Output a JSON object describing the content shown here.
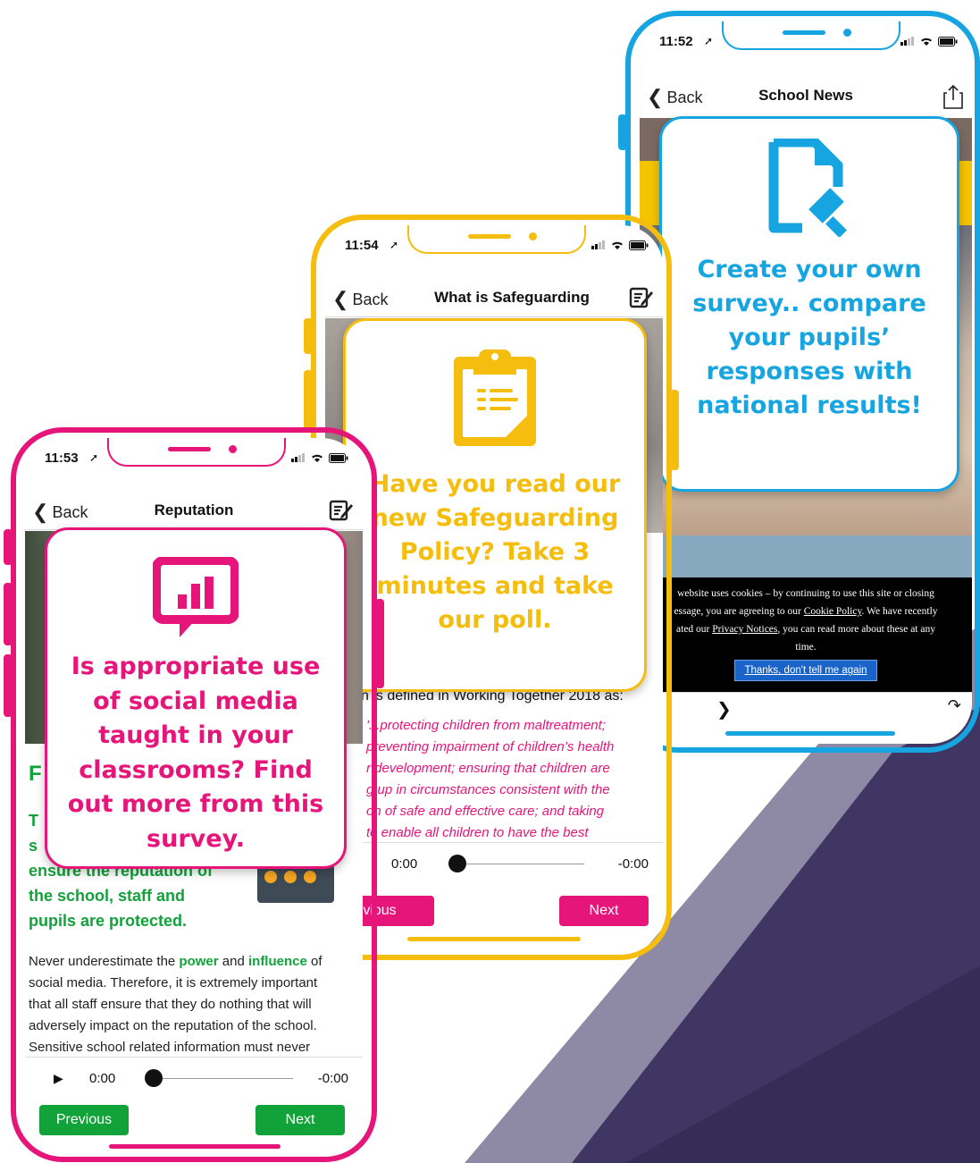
{
  "colors": {
    "pink": "#e6157a",
    "yellow": "#f5bd0d",
    "blue": "#16a5e0",
    "green": "#12a23a",
    "purple_dark": "#3f3663",
    "purple_mid": "#8e8aa6"
  },
  "phone_right": {
    "time": "11:52",
    "back_label": "Back",
    "title": "School News",
    "nav_icon": "share-icon",
    "card_icon": "document-search-icon",
    "card_text": "Create your own survey.. compare your pupils’ responses with national results!",
    "cookie": {
      "line1": "website uses cookies – by continuing to use this site or closing",
      "line2a": "essage, you are agreeing to our ",
      "cookie_link": "Cookie Policy",
      "line2b": ". We have recently",
      "line3a": "ated our ",
      "privacy_link": "Privacy Notices",
      "line3b": ", you can read more about these at any",
      "line4": "time.",
      "button": "Thanks, don't tell me again"
    }
  },
  "phone_middle": {
    "time": "11:54",
    "back_label": "Back",
    "title": "What is Safeguarding",
    "nav_icon": "edit-note-icon",
    "card_icon": "clipboard-icon",
    "card_text": "Have you read our new Safeguarding Policy? Take 3 minutes and take our poll.",
    "defined_text": "n is defined in Working Together 2018 as:",
    "quote_lines": [
      "'...protecting children from maltreatment;",
      "preventing impairment of children’s health",
      "r development; ensuring that children are",
      "g up in circumstances consistent with the",
      "on of safe and effective care; and taking",
      "to enable all children to have the best"
    ],
    "audio_start": "0:00",
    "audio_end": "-0:00",
    "prev_label": "vious",
    "next_label": "Next"
  },
  "phone_left": {
    "time": "11:53",
    "back_label": "Back",
    "title": "Reputation",
    "nav_icon": "edit-note-icon",
    "card_icon": "bar-chart-icon",
    "card_text": "Is appropriate use of social media taught in your classrooms? Find out more from this survey.",
    "heading_peek": "F",
    "green_peek_t": "T",
    "green_peek_s": "s",
    "green_line_cut": "ensure the reputation of",
    "green_line2": "the school, staff and",
    "green_line3": "pupils are protected.",
    "para_prefix": "Never underestimate the ",
    "para_power": "power",
    "para_and": " and ",
    "para_influence": "influence",
    "para_of": " of",
    "para_rest": [
      "social media. Therefore, it is extremely important",
      "that all staff ensure that they do nothing that will",
      "adversely impact on the reputation of the school.",
      "Sensitive school related information must never"
    ],
    "audio_start": "0:00",
    "audio_end": "-0:00",
    "prev_label": "Previous",
    "next_label": "Next"
  }
}
